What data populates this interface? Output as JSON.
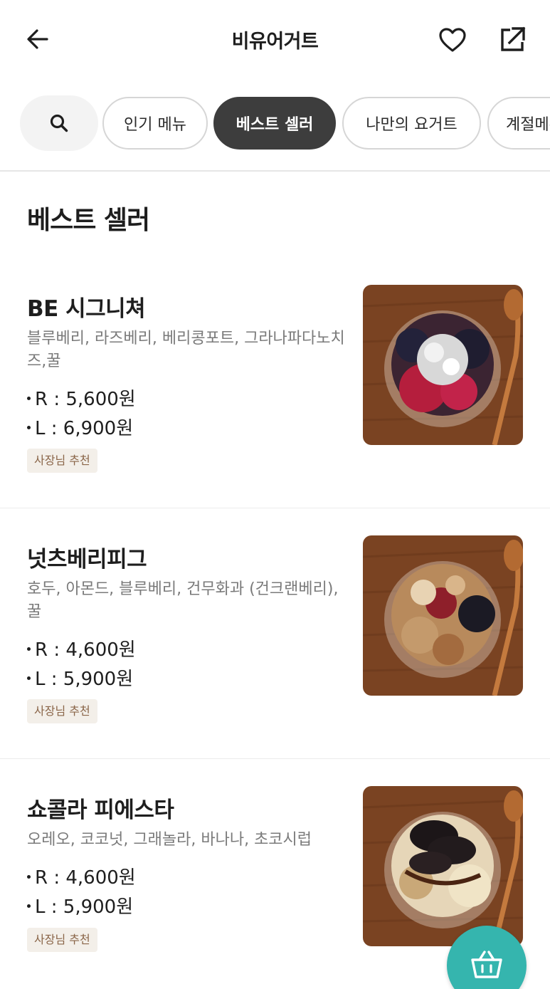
{
  "header": {
    "title": "비유어거트",
    "back_icon": "arrow-left-icon",
    "favorite_icon": "heart-outline-icon",
    "share_icon": "share-external-icon"
  },
  "tabs": {
    "search_icon": "search-icon",
    "items": [
      {
        "label": "인기 메뉴",
        "active": false
      },
      {
        "label": "베스트 셀러",
        "active": true
      },
      {
        "label": "나만의 요거트",
        "active": false
      },
      {
        "label": "계절메뉴",
        "active": false
      }
    ]
  },
  "section": {
    "title": "베스트 셀러"
  },
  "menu_items": [
    {
      "name": "BE 시그니쳐",
      "description": "블루베리, 라즈베리, 베리콩포트, 그라나파다노치즈,꿀",
      "price_r": "R : 5,600원",
      "price_l": "L : 6,900원",
      "badge": "사장님 추천"
    },
    {
      "name": "넛츠베리피그",
      "description": "호두, 아몬드, 블루베리, 건무화과 (건크랜베리), 꿀",
      "price_r": "R : 4,600원",
      "price_l": "L : 5,900원",
      "badge": "사장님 추천"
    },
    {
      "name": "쇼콜라 피에스타",
      "description": "오레오, 코코넛, 그래놀라, 바나나, 초코시럽",
      "price_r": "R : 4,600원",
      "price_l": "L : 5,900원",
      "badge": "사장님 추천"
    }
  ],
  "cart": {
    "icon": "basket-icon"
  },
  "colors": {
    "accent": "#35b5ae",
    "chip_active": "#3d3d3d",
    "badge_bg": "#f3efe9",
    "badge_text": "#8a6548"
  }
}
